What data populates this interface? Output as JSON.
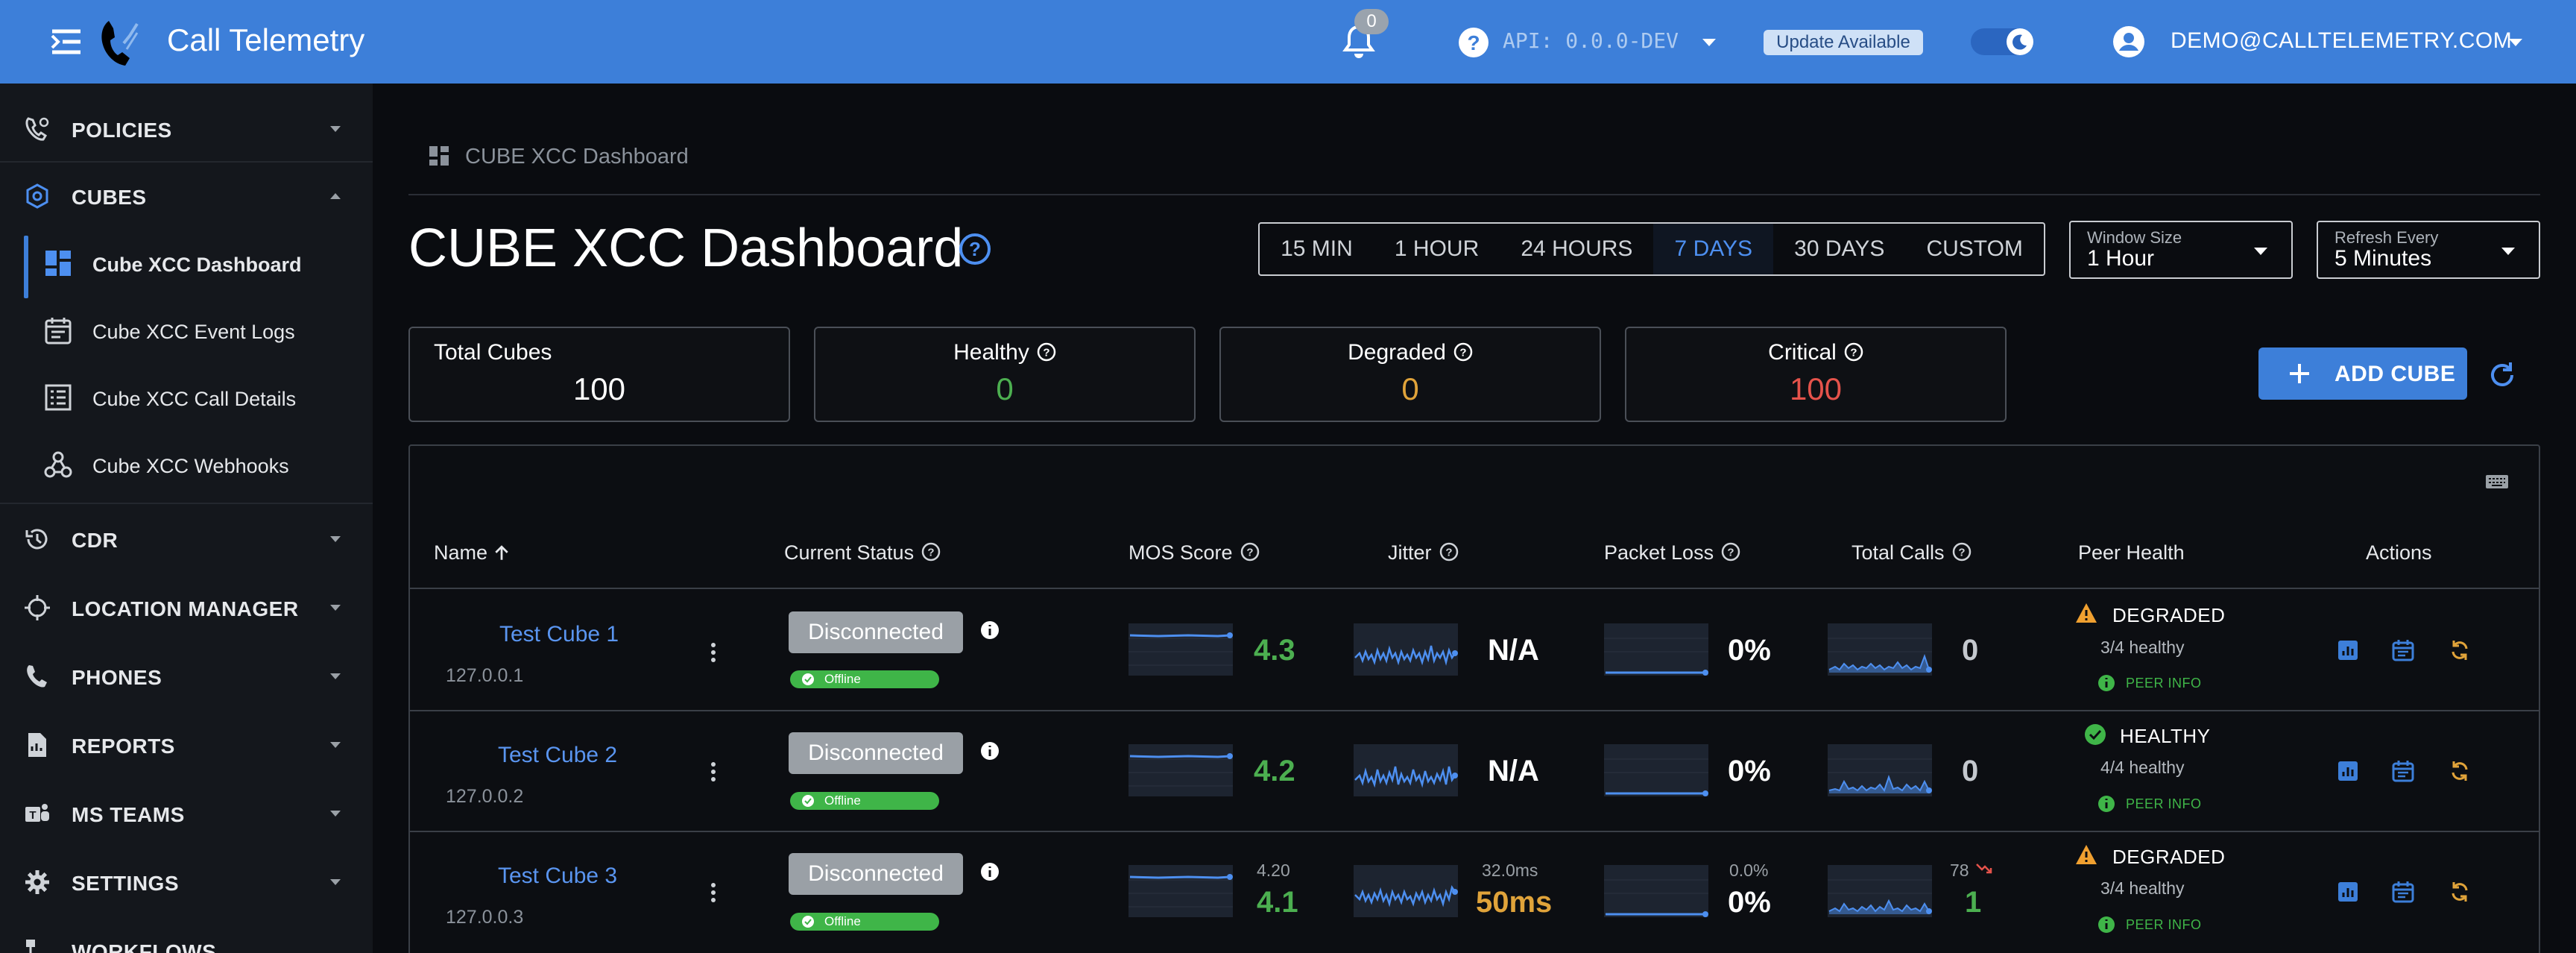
{
  "app": {
    "title": "Call Telemetry"
  },
  "topbar": {
    "notifications_count": "0",
    "api_label": "API: 0.0.0-DEV",
    "update_badge": "Update Available",
    "user_email": "DEMO@CALLTELEMETRY.COM"
  },
  "sidebar": {
    "sections": [
      {
        "label": "POLICIES",
        "icon": "phone-settings-icon"
      },
      {
        "label": "CUBES",
        "icon": "cube-icon"
      },
      {
        "label": "CDR",
        "icon": "history-icon"
      },
      {
        "label": "LOCATION MANAGER",
        "icon": "crosshair-icon"
      },
      {
        "label": "PHONES",
        "icon": "phone-icon"
      },
      {
        "label": "REPORTS",
        "icon": "report-icon"
      },
      {
        "label": "MS TEAMS",
        "icon": "teams-icon"
      },
      {
        "label": "SETTINGS",
        "icon": "gear-icon"
      },
      {
        "label": "WORKFLOWS",
        "icon": "workflow-icon"
      }
    ],
    "cube_items": [
      {
        "label": "Cube XCC Dashboard",
        "icon": "dashboard-icon",
        "active": true
      },
      {
        "label": "Cube XCC Event Logs",
        "icon": "calendar-icon",
        "active": false
      },
      {
        "label": "Cube XCC Call Details",
        "icon": "list-icon",
        "active": false
      },
      {
        "label": "Cube XCC Webhooks",
        "icon": "webhook-icon",
        "active": false
      }
    ]
  },
  "breadcrumb": {
    "label": "CUBE XCC Dashboard"
  },
  "page": {
    "title": "CUBE XCC Dashboard"
  },
  "time_ranges": [
    "15 MIN",
    "1 HOUR",
    "24 HOURS",
    "7 DAYS",
    "30 DAYS",
    "CUSTOM"
  ],
  "active_range": "7 DAYS",
  "window_size": {
    "label": "Window Size",
    "value": "1 Hour"
  },
  "refresh_every": {
    "label": "Refresh Every",
    "value": "5 Minutes"
  },
  "stats": {
    "total": {
      "label": "Total Cubes",
      "value": "100"
    },
    "healthy": {
      "label": "Healthy",
      "value": "0"
    },
    "degraded": {
      "label": "Degraded",
      "value": "0"
    },
    "critical": {
      "label": "Critical",
      "value": "100"
    }
  },
  "actions": {
    "add_cube": "ADD CUBE"
  },
  "table": {
    "columns": {
      "name": "Name",
      "status": "Current Status",
      "mos": "MOS Score",
      "jitter": "Jitter",
      "packet_loss": "Packet Loss",
      "total_calls": "Total Calls",
      "peer_health": "Peer Health",
      "actions": "Actions"
    },
    "rows": [
      {
        "name": "Test Cube 1",
        "ip": "127.0.0.1",
        "status": "Disconnected",
        "chip": "Offline",
        "mos_prev": "",
        "mos": "4.3",
        "jitter_prev": "",
        "jitter": "N/A",
        "loss_prev": "",
        "loss": "0%",
        "calls_prev": "",
        "calls": "0",
        "peer_state": "DEGRADED",
        "peer_count": "3/4 healthy",
        "peer_info": "PEER INFO"
      },
      {
        "name": "Test Cube 2",
        "ip": "127.0.0.2",
        "status": "Disconnected",
        "chip": "Offline",
        "mos_prev": "",
        "mos": "4.2",
        "jitter_prev": "",
        "jitter": "N/A",
        "loss_prev": "",
        "loss": "0%",
        "calls_prev": "",
        "calls": "0",
        "peer_state": "HEALTHY",
        "peer_count": "4/4 healthy",
        "peer_info": "PEER INFO"
      },
      {
        "name": "Test Cube 3",
        "ip": "127.0.0.3",
        "status": "Disconnected",
        "chip": "Offline",
        "mos_prev": "4.20",
        "mos": "4.1",
        "jitter_prev": "32.0ms",
        "jitter": "50ms",
        "loss_prev": "0.0%",
        "loss": "0%",
        "calls_prev": "78",
        "calls": "1",
        "peer_state": "DEGRADED",
        "peer_count": "3/4 healthy",
        "peer_info": "PEER INFO"
      }
    ]
  },
  "colors": {
    "topbar": "#3d7fd9",
    "healthy": "#4caf50",
    "degraded": "#e0a33a",
    "critical": "#e5534b",
    "link": "#5a95f0"
  }
}
